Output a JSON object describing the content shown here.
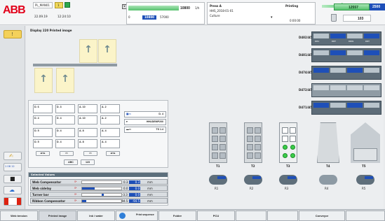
{
  "header": {
    "logo": "ABB",
    "user": "PL_MAN01",
    "level": "1",
    "date": "22.09.19",
    "time": "12:24:10",
    "progress_value": "10800",
    "progress_unit": "1/h",
    "progress_left": "0",
    "progress_mid": "10800",
    "progress_max": "57000",
    "press_name": "Press A",
    "press_date": "HHS_2018-01-01",
    "press_sub": "Culture",
    "status": "Printing",
    "timer": "0:00:00",
    "counter_green": "12557",
    "counter_blue": "2500",
    "waste_count": "103",
    "colors": {
      "brand": "#e2001a",
      "accent": "#1e4fb8",
      "ok": "#3acd49"
    }
  },
  "left_toolbar": {
    "icons": [
      "warning-icon",
      "signature-icon",
      "network-icon",
      "camera-icon",
      "cloud-icon",
      "flag-icon"
    ],
    "badge": "1 08 12"
  },
  "display": {
    "title": "Display 220 Printed image"
  },
  "plate_panel": {
    "rows": [
      [
        "D. 6",
        "D. 3",
        "A. 10",
        "A. 2"
      ],
      [
        "D. 4",
        "D. 4",
        "A. 10",
        "A. 2"
      ],
      [
        "D. 5",
        "D. 4",
        "A. 8",
        "A. 4"
      ],
      [
        "D. 5",
        "D. 4",
        "A. 8",
        "A. 4"
      ]
    ],
    "side_fields": [
      "D. 4",
      "HHUDEMP200",
      "TS 1.4"
    ],
    "btn_abc": "ABC",
    "btn_123": "123"
  },
  "selected_values": {
    "title": "Selected Values",
    "rows": [
      {
        "label": "Web Compensator",
        "value": "0.3",
        "set": "0.3",
        "unit": "mm"
      },
      {
        "label": "Web sidelay",
        "value": "0.0",
        "set": "0.0",
        "unit": "mm"
      },
      {
        "label": "Turner bar",
        "value": "-3.3",
        "set": "0.0",
        "unit": "mm"
      },
      {
        "label": "Ribbon Compensator",
        "value": "-94.5",
        "set": "-94.5",
        "unit": "mm"
      }
    ]
  },
  "towers": {
    "labels": [
      "T1",
      "T2",
      "T3",
      "T4",
      "T5"
    ],
    "reel_labels": [
      "R1",
      "R2",
      "R3",
      "R4",
      "R5"
    ]
  },
  "positions": {
    "rows": [
      "D482/A5",
      "D481/A5",
      "D474/A5",
      "D472/A5",
      "D471/A5"
    ],
    "cell_codes": [
      "DRV",
      "DRT",
      "DRW",
      "DRT"
    ]
  },
  "bottom_tabs": [
    "Web tension",
    "Printed image",
    "Ink / water",
    "Print sequence",
    "Folder",
    "PCU",
    "",
    "",
    "Conveyor",
    ""
  ]
}
